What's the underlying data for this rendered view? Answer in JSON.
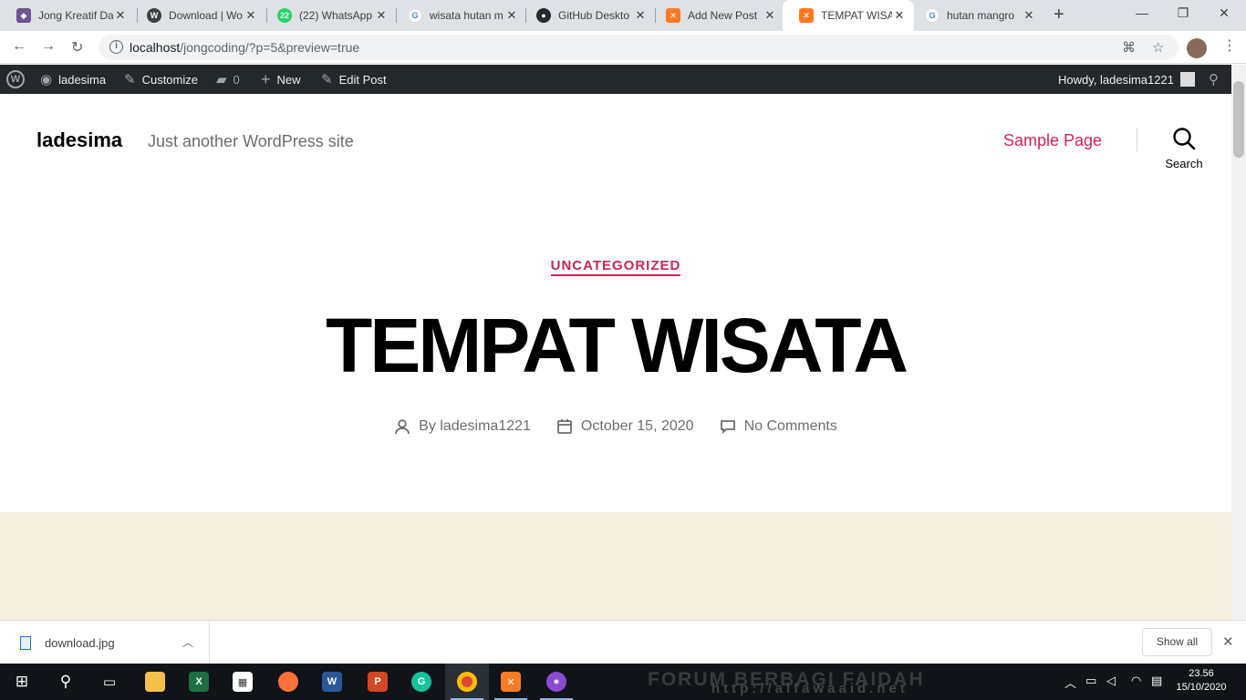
{
  "browser": {
    "tabs": [
      {
        "title": "Jong Kreatif Da",
        "favicon": "octocat-icon",
        "color": "#6e5494"
      },
      {
        "title": "Download | Wo",
        "favicon": "wordpress-icon",
        "color": "#3c4043"
      },
      {
        "title": "(22) WhatsApp",
        "favicon": "whatsapp-icon",
        "color": "#25d366",
        "badge": "22"
      },
      {
        "title": "wisata hutan m",
        "favicon": "google-icon",
        "color": "#4285f4"
      },
      {
        "title": "GitHub Deskto",
        "favicon": "github-icon",
        "color": "#24292e"
      },
      {
        "title": "Add New Post",
        "favicon": "xampp-icon",
        "color": "#fb7a24"
      },
      {
        "title": "TEMPAT WISAT",
        "favicon": "xampp-icon",
        "color": "#fb7a24",
        "active": true
      },
      {
        "title": "hutan mangro",
        "favicon": "google-icon",
        "color": "#4285f4"
      }
    ],
    "url_host": "localhost",
    "url_path": "/jongcoding/?p=5&preview=true"
  },
  "adminbar": {
    "site": "ladesima",
    "customize": "Customize",
    "comments_count": "0",
    "new": "New",
    "edit": "Edit Post",
    "howdy": "Howdy, ladesima1221"
  },
  "site": {
    "title": "ladesima",
    "tagline": "Just another WordPress site",
    "menu_item": "Sample Page",
    "search_label": "Search"
  },
  "post": {
    "category": "UNCATEGORIZED",
    "title": "TEMPAT WISATA",
    "author": "By ladesima1221",
    "date": "October 15, 2020",
    "comments": "No Comments"
  },
  "downloads": {
    "file": "download.jpg",
    "show_all": "Show all"
  },
  "taskbar": {
    "wallpaper_text": "FORUM BERBAGI FAIDAH",
    "wallpaper_sub": "http://alfawaaid.net",
    "time": "23.56",
    "date": "15/10/2020"
  },
  "colors": {
    "accent": "#cd2653",
    "admin_bg": "#23282d",
    "beige": "#f5efe0"
  }
}
